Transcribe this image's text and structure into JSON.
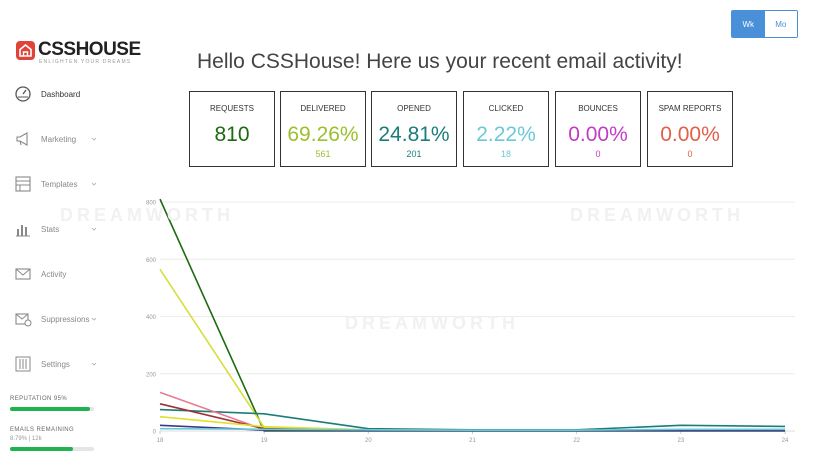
{
  "header": {
    "period_toggle": {
      "week_label": "Wk",
      "month_label": "Mo",
      "active": "Wk"
    },
    "greeting": "Hello CSSHouse! Here us your recent email activity!"
  },
  "logo": {
    "name": "CSSHOUSE",
    "tagline": "ENLIGHTEN YOUR DREAMS"
  },
  "watermark_text": "DREAMWORTH",
  "sidebar": {
    "items": [
      {
        "label": "Dashboard",
        "icon": "gauge-icon",
        "active": true,
        "has_chevron": false
      },
      {
        "label": "Marketing",
        "icon": "megaphone-icon",
        "active": false,
        "has_chevron": true
      },
      {
        "label": "Templates",
        "icon": "template-icon",
        "active": false,
        "has_chevron": true
      },
      {
        "label": "Stats",
        "icon": "bar-chart-icon",
        "active": false,
        "has_chevron": true
      },
      {
        "label": "Activity",
        "icon": "envelope-icon",
        "active": false,
        "has_chevron": false
      },
      {
        "label": "Suppressions",
        "icon": "envelope-block-icon",
        "active": false,
        "has_chevron": true
      },
      {
        "label": "Settings",
        "icon": "sliders-icon",
        "active": false,
        "has_chevron": true
      }
    ],
    "reputation": {
      "label": "REPUTATION 95%",
      "value": 95
    },
    "emails_remaining": {
      "label": "EMAILS REMAINING",
      "sub": "8.79% | 12k",
      "fill_fraction": 0.75
    }
  },
  "stats": [
    {
      "label": "REQUESTS",
      "value": "810",
      "sub": "",
      "color": "#1e6a12"
    },
    {
      "label": "DELIVERED",
      "value": "69.26%",
      "sub": "561",
      "color": "#9cbf2e"
    },
    {
      "label": "OPENED",
      "value": "24.81%",
      "sub": "201",
      "color": "#1b7d7a"
    },
    {
      "label": "CLICKED",
      "value": "2.22%",
      "sub": "18",
      "color": "#6cc8d6"
    },
    {
      "label": "BOUNCES",
      "value": "0.00%",
      "sub": "0",
      "color": "#c23cc5"
    },
    {
      "label": "SPAM REPORTS",
      "value": "0.00%",
      "sub": "0",
      "color": "#e0604a"
    }
  ],
  "chart_data": {
    "type": "line",
    "x": [
      "18",
      "19",
      "20",
      "21",
      "22",
      "23",
      "24"
    ],
    "ylim": [
      0,
      800
    ],
    "yticks": [
      "800",
      "600",
      "400",
      "200",
      "0"
    ],
    "grid": true,
    "series": [
      {
        "values": [
          810,
          0,
          0,
          0,
          0,
          0,
          0
        ],
        "color": "#1e6a12"
      },
      {
        "values": [
          565,
          12,
          3,
          2,
          2,
          3,
          3
        ],
        "color": "#d6df3a"
      },
      {
        "values": [
          75,
          60,
          8,
          4,
          4,
          20,
          16
        ],
        "color": "#1b7d7a"
      },
      {
        "values": [
          135,
          5,
          2,
          1,
          1,
          2,
          2
        ],
        "color": "#e87b8f"
      },
      {
        "values": [
          95,
          8,
          2,
          1,
          1,
          2,
          2
        ],
        "color": "#a03030"
      },
      {
        "values": [
          50,
          15,
          4,
          2,
          2,
          3,
          3
        ],
        "color": "#e0e030"
      },
      {
        "values": [
          20,
          3,
          1,
          1,
          1,
          1,
          1
        ],
        "color": "#3a3a8c"
      },
      {
        "values": [
          8,
          6,
          4,
          3,
          3,
          6,
          6
        ],
        "color": "#6cc8d6"
      }
    ]
  }
}
